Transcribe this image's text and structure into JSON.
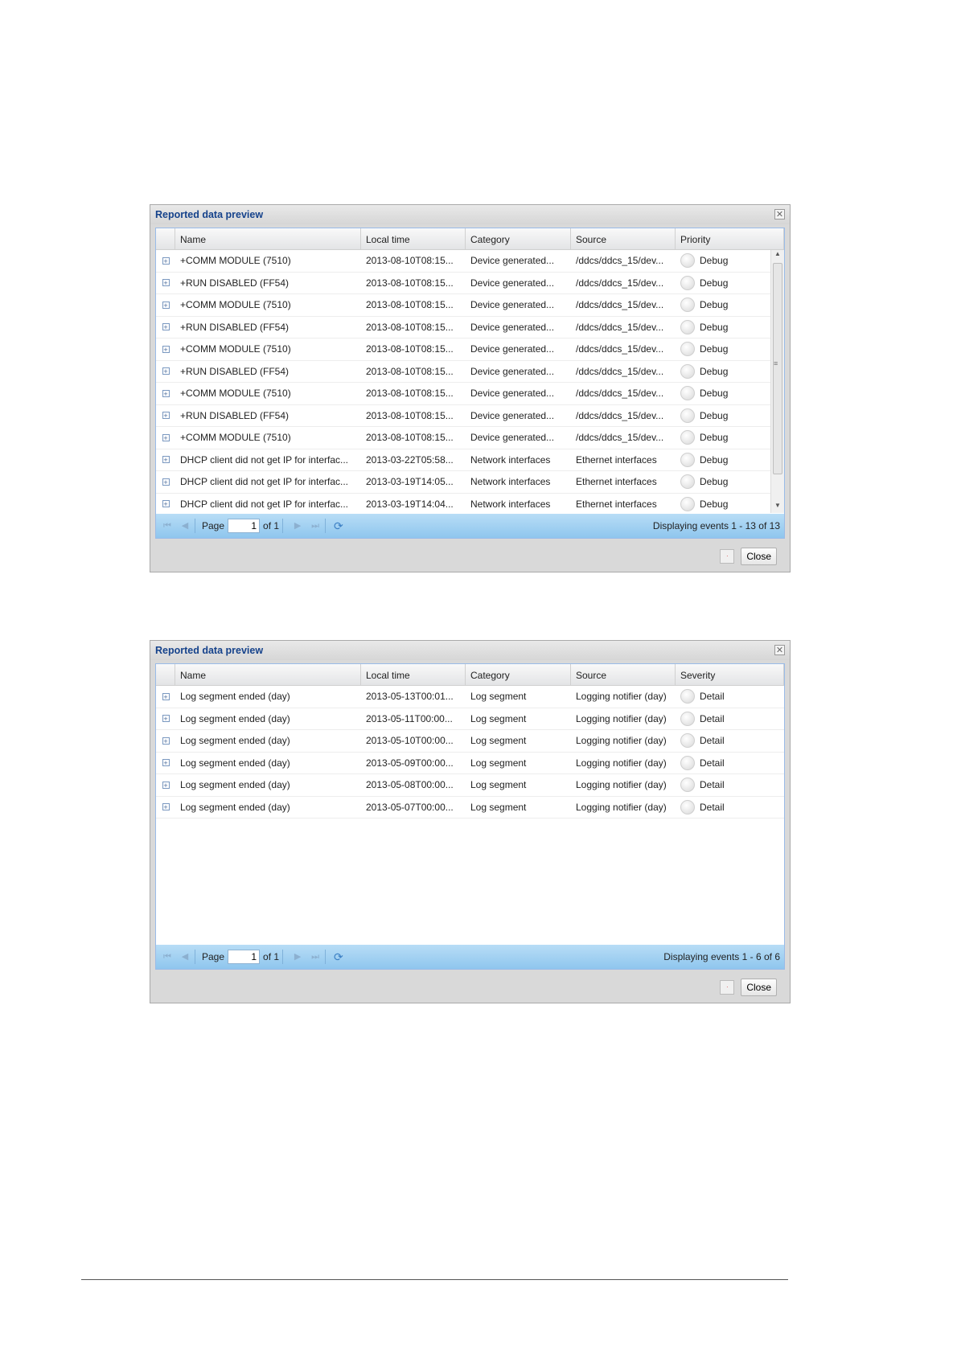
{
  "dialogs": [
    {
      "title": "Reported data preview",
      "columns": [
        "Name",
        "Local time",
        "Category",
        "Source",
        "Priority"
      ],
      "rows": [
        [
          "+COMM MODULE (7510)",
          "2013-08-10T08:15...",
          "Device generated...",
          "/ddcs/ddcs_15/dev...",
          "Debug"
        ],
        [
          "+RUN DISABLED (FF54)",
          "2013-08-10T08:15...",
          "Device generated...",
          "/ddcs/ddcs_15/dev...",
          "Debug"
        ],
        [
          "+COMM MODULE (7510)",
          "2013-08-10T08:15...",
          "Device generated...",
          "/ddcs/ddcs_15/dev...",
          "Debug"
        ],
        [
          "+RUN DISABLED (FF54)",
          "2013-08-10T08:15...",
          "Device generated...",
          "/ddcs/ddcs_15/dev...",
          "Debug"
        ],
        [
          "+COMM MODULE (7510)",
          "2013-08-10T08:15...",
          "Device generated...",
          "/ddcs/ddcs_15/dev...",
          "Debug"
        ],
        [
          "+RUN DISABLED (FF54)",
          "2013-08-10T08:15...",
          "Device generated...",
          "/ddcs/ddcs_15/dev...",
          "Debug"
        ],
        [
          "+COMM MODULE (7510)",
          "2013-08-10T08:15...",
          "Device generated...",
          "/ddcs/ddcs_15/dev...",
          "Debug"
        ],
        [
          "+RUN DISABLED (FF54)",
          "2013-08-10T08:15...",
          "Device generated...",
          "/ddcs/ddcs_15/dev...",
          "Debug"
        ],
        [
          "+COMM MODULE (7510)",
          "2013-08-10T08:15...",
          "Device generated...",
          "/ddcs/ddcs_15/dev...",
          "Debug"
        ],
        [
          "DHCP client did not get IP for interfac...",
          "2013-03-22T05:58...",
          "Network interfaces",
          "Ethernet interfaces",
          "Debug"
        ],
        [
          "DHCP client did not get IP for interfac...",
          "2013-03-19T14:05...",
          "Network interfaces",
          "Ethernet interfaces",
          "Debug"
        ],
        [
          "DHCP client did not get IP for interfac...",
          "2013-03-19T14:04...",
          "Network interfaces",
          "Ethernet interfaces",
          "Debug"
        ]
      ],
      "pager": {
        "page_label": "Page",
        "page_value": "1",
        "of_label": "of 1",
        "info": "Displaying events 1 - 13 of 13"
      },
      "close_label": "Close"
    },
    {
      "title": "Reported data preview",
      "columns": [
        "Name",
        "Local time",
        "Category",
        "Source",
        "Severity"
      ],
      "rows": [
        [
          "Log segment ended (day)",
          "2013-05-13T00:01...",
          "Log segment",
          "Logging notifier (day)",
          "Detail"
        ],
        [
          "Log segment ended (day)",
          "2013-05-11T00:00...",
          "Log segment",
          "Logging notifier (day)",
          "Detail"
        ],
        [
          "Log segment ended (day)",
          "2013-05-10T00:00...",
          "Log segment",
          "Logging notifier (day)",
          "Detail"
        ],
        [
          "Log segment ended (day)",
          "2013-05-09T00:00...",
          "Log segment",
          "Logging notifier (day)",
          "Detail"
        ],
        [
          "Log segment ended (day)",
          "2013-05-08T00:00...",
          "Log segment",
          "Logging notifier (day)",
          "Detail"
        ],
        [
          "Log segment ended (day)",
          "2013-05-07T00:00...",
          "Log segment",
          "Logging notifier (day)",
          "Detail"
        ]
      ],
      "pager": {
        "page_label": "Page",
        "page_value": "1",
        "of_label": "of 1",
        "info": "Displaying events 1 - 6 of 6"
      },
      "close_label": "Close"
    }
  ]
}
